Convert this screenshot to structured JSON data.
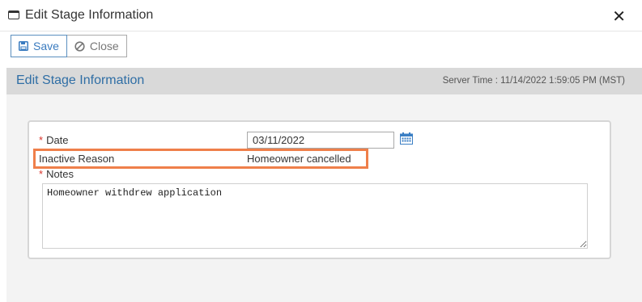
{
  "window": {
    "title": "Edit Stage Information",
    "close_symbol": "✕"
  },
  "toolbar": {
    "save_label": "Save",
    "close_label": "Close"
  },
  "header": {
    "title": "Edit Stage Information",
    "server_time": "Server Time : 11/14/2022 1:59:05 PM (MST)"
  },
  "form": {
    "required_marker": "*",
    "date_label": "Date",
    "date_value": "03/11/2022",
    "inactive_reason_label": "Inactive Reason",
    "inactive_reason_value": "Homeowner cancelled",
    "notes_label": "Notes",
    "notes_value": "Homeowner withdrew application"
  },
  "colors": {
    "accent": "#2f6ea5",
    "highlight": "#ef7f4a",
    "required": "#d9342b"
  }
}
